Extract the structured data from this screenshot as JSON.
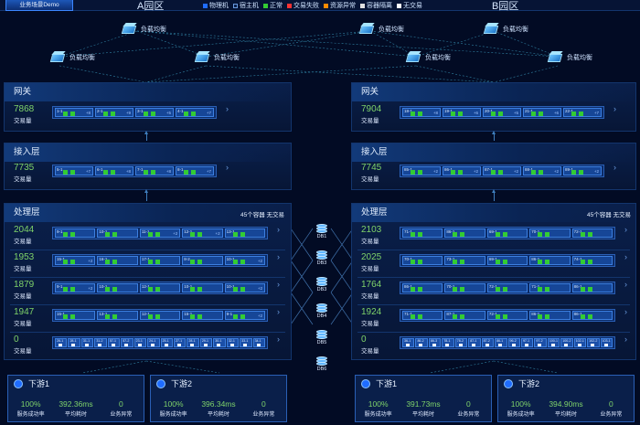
{
  "header": {
    "demo_tab": "业务场景Demo",
    "zone_a": "A园区",
    "zone_b": "B园区",
    "legend": [
      {
        "label": "物理机",
        "color": "#1f6cff"
      },
      {
        "label": "宿主机",
        "color": "#0a1f4a"
      },
      {
        "label": "正常",
        "color": "#33cc33"
      },
      {
        "label": "交易失败",
        "color": "#ff3333"
      },
      {
        "label": "资源异常",
        "color": "#ff8a00"
      },
      {
        "label": "容器隔离",
        "color": "#e0e0e0"
      },
      {
        "label": "无交易",
        "color": "#ffffff"
      }
    ]
  },
  "load_balancers": {
    "label": "负载均衡",
    "count": 6
  },
  "zones": {
    "a": {
      "gateway": {
        "title": "网关",
        "value": "7868",
        "label": "交易量",
        "nodes": [
          {
            "id": "1-1",
            "plus": "+8"
          },
          {
            "id": "2-1",
            "plus": "+9"
          },
          {
            "id": "3-1",
            "plus": "+5"
          },
          {
            "id": "4-1",
            "plus": "+7"
          }
        ]
      },
      "access": {
        "title": "接入层",
        "value": "7735",
        "label": "交易量",
        "nodes": [
          {
            "id": "5-1",
            "plus": "+7"
          },
          {
            "id": "6-1",
            "plus": "+8"
          },
          {
            "id": "7-1",
            "plus": "+8"
          },
          {
            "id": "8-1",
            "plus": "+7"
          }
        ]
      },
      "processing": {
        "title": "处理层",
        "badge": "45个容器 无交易",
        "rows": [
          {
            "value": "2044",
            "label": "交易量",
            "nodes": [
              {
                "id": "9-1",
                "plus": ""
              },
              {
                "id": "10-1",
                "plus": ""
              },
              {
                "id": "11-1",
                "plus": "+2"
              },
              {
                "id": "12-1",
                "plus": "+2"
              },
              {
                "id": "13-1",
                "plus": ""
              }
            ]
          },
          {
            "value": "1953",
            "label": "交易量",
            "nodes": [
              {
                "id": "15-1",
                "plus": "+2"
              },
              {
                "id": "16-1",
                "plus": ""
              },
              {
                "id": "17-1",
                "plus": ""
              },
              {
                "id": "8-2",
                "plus": ""
              },
              {
                "id": "10-1",
                "plus": "+2"
              }
            ]
          },
          {
            "value": "1879",
            "label": "交易量",
            "nodes": [
              {
                "id": "9-1",
                "plus": "+2"
              },
              {
                "id": "10-1",
                "plus": ""
              },
              {
                "id": "12-1",
                "plus": ""
              },
              {
                "id": "10-1",
                "plus": ""
              },
              {
                "id": "10-1",
                "plus": "+2"
              }
            ]
          },
          {
            "value": "1947",
            "label": "交易量",
            "nodes": [
              {
                "id": "15-1",
                "plus": ""
              },
              {
                "id": "13-1",
                "plus": ""
              },
              {
                "id": "12-1",
                "plus": ""
              },
              {
                "id": "15-1",
                "plus": ""
              },
              {
                "id": "9-1",
                "plus": "+2"
              }
            ]
          },
          {
            "value": "0",
            "label": "交易量",
            "small": [
              "26-1",
              "28-1",
              "31-1",
              "31-2",
              "57-1",
              "57-2",
              "23-1",
              "24-1",
              "25-1",
              "27-1",
              "28-1",
              "29-1",
              "30-1",
              "32-1",
              "33-1",
              "34-1"
            ]
          }
        ]
      },
      "downstream": [
        {
          "title": "下游1",
          "rate": "100%",
          "rate_label": "服务成功率",
          "latency": "392.36ms",
          "latency_label": "平均耗时",
          "errors": "0",
          "errors_label": "业务异常"
        },
        {
          "title": "下游2",
          "rate": "100%",
          "rate_label": "服务成功率",
          "latency": "396.34ms",
          "latency_label": "平均耗时",
          "errors": "0",
          "errors_label": "业务异常"
        }
      ]
    },
    "b": {
      "gateway": {
        "title": "网关",
        "value": "7904",
        "label": "交易量",
        "nodes": [
          {
            "id": "18-1",
            "plus": "+8"
          },
          {
            "id": "19-1",
            "plus": "+6"
          },
          {
            "id": "20-1",
            "plus": "+5"
          },
          {
            "id": "21-1",
            "plus": "+6"
          },
          {
            "id": "22-1",
            "plus": "+7"
          }
        ]
      },
      "access": {
        "title": "接入层",
        "value": "7745",
        "label": "交易量",
        "nodes": [
          {
            "id": "85-1",
            "plus": "+2"
          },
          {
            "id": "86-1",
            "plus": "+2"
          },
          {
            "id": "87-1",
            "plus": "+2"
          },
          {
            "id": "88-1",
            "plus": "+2"
          },
          {
            "id": "89-1",
            "plus": "+2"
          }
        ]
      },
      "processing": {
        "title": "处理层",
        "badge": "45个容器 无交易",
        "rows": [
          {
            "value": "2103",
            "label": "交易量",
            "nodes": [
              {
                "id": "71-1",
                "plus": ""
              },
              {
                "id": "86-1",
                "plus": ""
              },
              {
                "id": "69-1",
                "plus": ""
              },
              {
                "id": "70-1",
                "plus": ""
              },
              {
                "id": "72-1",
                "plus": ""
              }
            ]
          },
          {
            "value": "2025",
            "label": "交易量",
            "nodes": [
              {
                "id": "70-1",
                "plus": ""
              },
              {
                "id": "73-1",
                "plus": ""
              },
              {
                "id": "69-1",
                "plus": ""
              },
              {
                "id": "86-1",
                "plus": ""
              },
              {
                "id": "74-1",
                "plus": ""
              }
            ]
          },
          {
            "value": "1764",
            "label": "交易量",
            "nodes": [
              {
                "id": "86-1",
                "plus": ""
              },
              {
                "id": "70-1",
                "plus": ""
              },
              {
                "id": "72-1",
                "plus": ""
              },
              {
                "id": "71-1",
                "plus": ""
              },
              {
                "id": "86-1",
                "plus": ""
              }
            ]
          },
          {
            "value": "1924",
            "label": "交易量",
            "nodes": [
              {
                "id": "71-1",
                "plus": ""
              },
              {
                "id": "87-1",
                "plus": ""
              },
              {
                "id": "72-1",
                "plus": ""
              },
              {
                "id": "86-1",
                "plus": ""
              },
              {
                "id": "86-1",
                "plus": ""
              }
            ]
          },
          {
            "value": "0",
            "label": "交易量",
            "small": [
              "36-1",
              "86-2",
              "86-3",
              "78-1",
              "78-2",
              "87-1",
              "87-2",
              "86-1",
              "96-2",
              "97-1",
              "97-2",
              "100-1",
              "100-2",
              "102-1",
              "102-2",
              "103-1"
            ]
          }
        ]
      },
      "downstream": [
        {
          "title": "下游1",
          "rate": "100%",
          "rate_label": "服务成功率",
          "latency": "391.73ms",
          "latency_label": "平均耗时",
          "errors": "0",
          "errors_label": "业务异常"
        },
        {
          "title": "下游2",
          "rate": "100%",
          "rate_label": "服务成功率",
          "latency": "394.90ms",
          "latency_label": "平均耗时",
          "errors": "0",
          "errors_label": "业务异常"
        }
      ]
    }
  },
  "databases": [
    "DB1",
    "DB3",
    "DB3",
    "DB4",
    "DB5",
    "DB6"
  ]
}
